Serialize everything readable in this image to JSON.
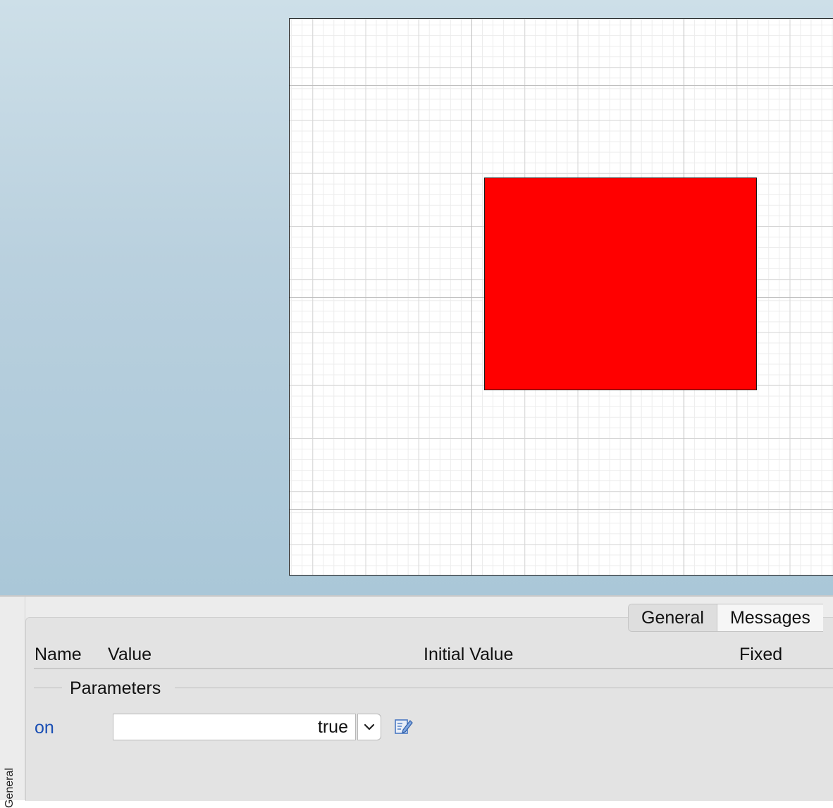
{
  "canvas": {
    "shape_fill": "#ff0000",
    "shape_icon": "red-rectangle"
  },
  "panel": {
    "side_tab_label": "General",
    "tabs": [
      {
        "label": "General",
        "active": true
      },
      {
        "label": "Messages",
        "active": false
      }
    ],
    "columns": {
      "name": "Name",
      "value": "Value",
      "initial_value": "Initial Value",
      "fixed": "Fixed"
    },
    "group_label": "Parameters",
    "parameter": {
      "name": "on",
      "value": "true",
      "dropdown_icon": "chevron-down-icon",
      "edit_icon": "edit-icon"
    },
    "colors": {
      "parameter_name": "#1a4fb4"
    }
  }
}
